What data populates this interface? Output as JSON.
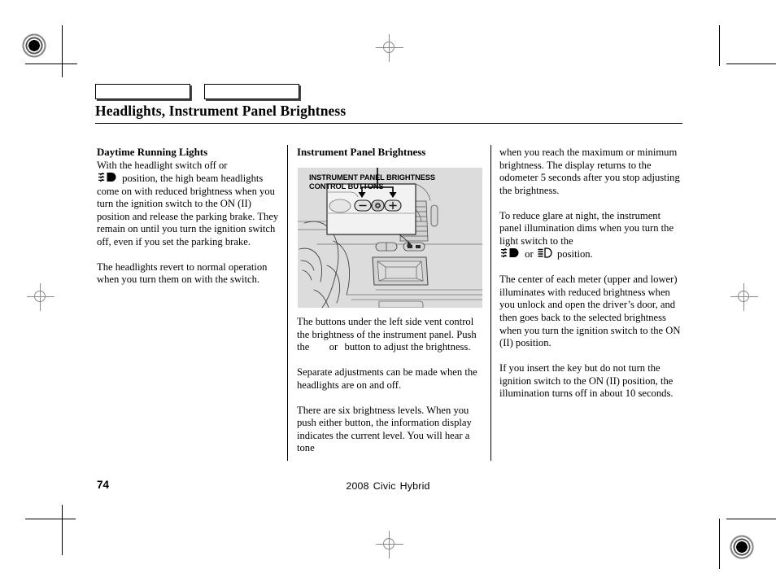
{
  "document": {
    "title": "Headlights, Instrument Panel Brightness",
    "page_number": "74",
    "footer_model": "2008  Civic  Hybrid",
    "footer_model_parts": [
      "2008",
      "Civic",
      "Hybrid"
    ]
  },
  "tabs": [
    {
      "label": ""
    },
    {
      "label": ""
    }
  ],
  "column_1": {
    "heading": "Daytime Running Lights",
    "paragraph_1_before_symbol": "With the headlight switch off or",
    "paragraph_1_after_symbol": "position, the high beam headlights come on with reduced brightness when you turn the ignition switch to the ON (II) position and release the parking brake. They remain on until you turn the ignition switch off, even if you set the parking brake.",
    "paragraph_2": "The headlights revert to normal operation when you turn them on with the switch."
  },
  "column_2": {
    "heading": "Instrument Panel Brightness",
    "figure": {
      "caption": "INSTRUMENT PANEL BRIGHTNESS\nCONTROL BUTTONS",
      "background_color": "#dcdcdc",
      "buttons": [
        "−",
        "⊕",
        "+"
      ],
      "description": "Dashboard illustration with magnified callout of the instrument panel brightness control buttons under the left side vent"
    },
    "paragraph_1_part_1": "The buttons under the left side vent control the brightness of the instrument panel. Push the",
    "paragraph_1_part_2": "or",
    "paragraph_1_part_3": "button to adjust the brightness.",
    "paragraph_2": "Separate adjustments can be made when the headlights are on and off.",
    "paragraph_3": "There are six brightness levels. When you push either button, the information display indicates the current level. You will hear a tone"
  },
  "column_3": {
    "paragraph_1": "when you reach the maximum or minimum brightness. The display returns to the odometer 5 seconds after you stop adjusting the brightness.",
    "paragraph_2_part_1": "To reduce glare at night, the instrument panel illumination dims when you turn the light switch to the",
    "paragraph_2_conjunction": "or",
    "paragraph_2_part_2": "position.",
    "paragraph_3": "The center of each meter (upper and lower) illuminates with reduced brightness when you unlock and open the driver’s door, and then goes back to the selected brightness when you turn the ignition switch to the ON (II) position.",
    "paragraph_4": "If you insert the key but do not turn the ignition switch to the ON (II) position, the illumination turns off in about 10 seconds."
  },
  "symbols": {
    "headlight_low_beam": "low-beam-headlight-symbol",
    "parking_light": "parking-light-symbol"
  }
}
